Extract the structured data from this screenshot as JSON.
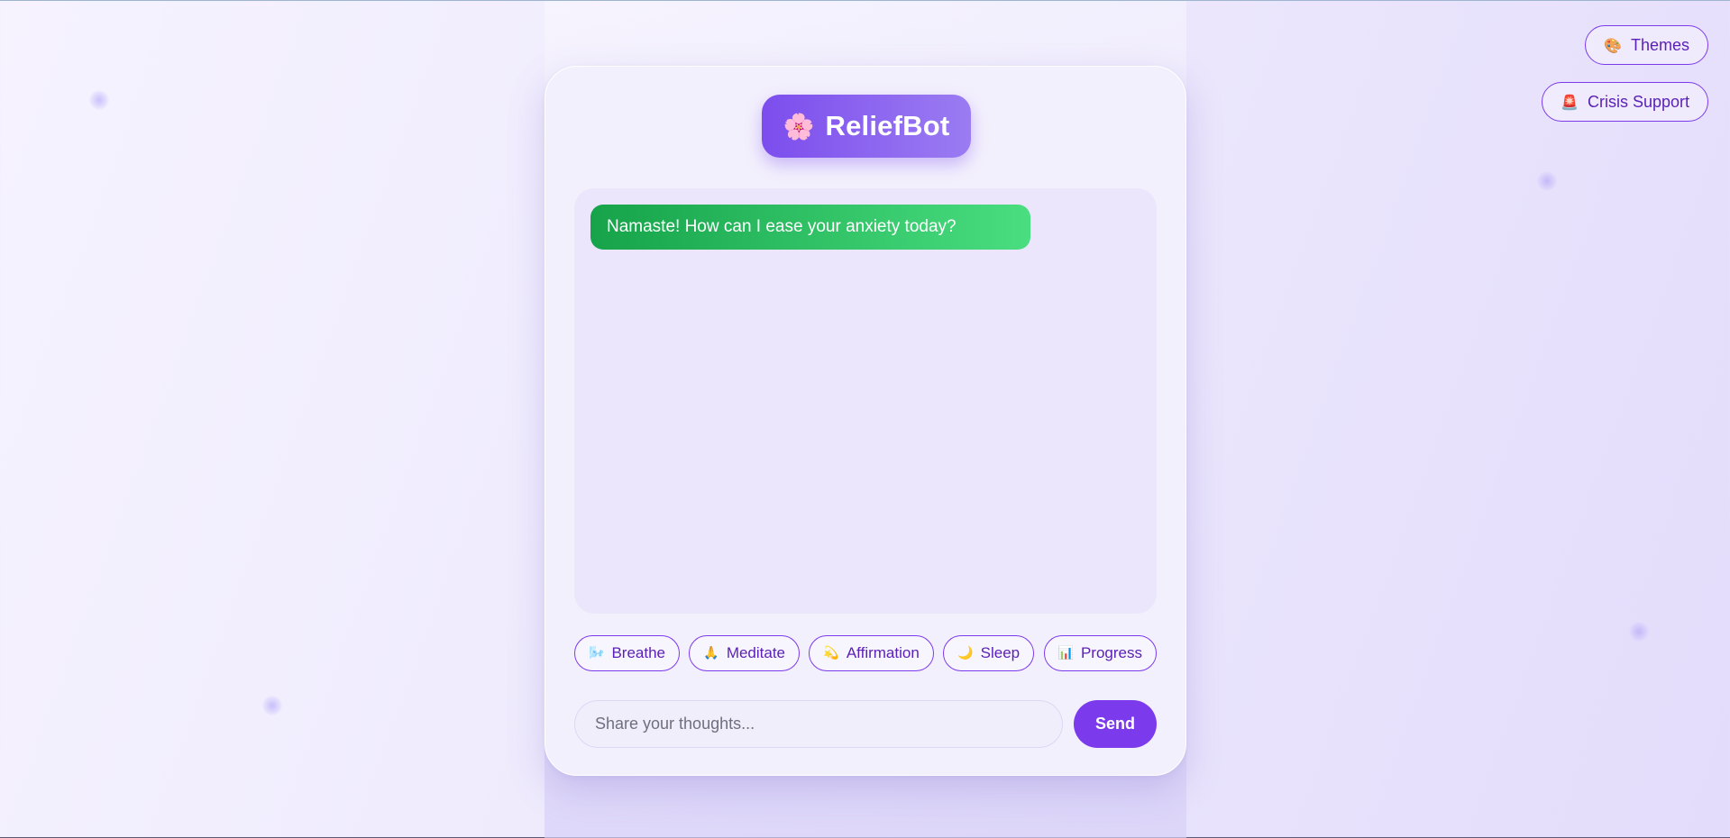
{
  "app": {
    "title": "ReliefBot",
    "logo_icon": "🌸"
  },
  "top_actions": {
    "themes": {
      "icon": "🎨",
      "label": "Themes"
    },
    "crisis": {
      "icon": "🚨",
      "label": "Crisis Support"
    }
  },
  "chat": {
    "messages": [
      {
        "sender": "bot",
        "text": "Namaste! How can I ease your anxiety today?"
      }
    ]
  },
  "quick_actions": [
    {
      "icon": "🌬️",
      "label": "Breathe"
    },
    {
      "icon": "🙏",
      "label": "Meditate"
    },
    {
      "icon": "💫",
      "label": "Affirmation"
    },
    {
      "icon": "🌙",
      "label": "Sleep"
    },
    {
      "icon": "📊",
      "label": "Progress"
    }
  ],
  "composer": {
    "placeholder": "Share your thoughts...",
    "value": "",
    "send_label": "Send"
  },
  "colors": {
    "accent": "#7c3aed",
    "bubble_start": "#16a34a",
    "bubble_end": "#4ade80"
  }
}
